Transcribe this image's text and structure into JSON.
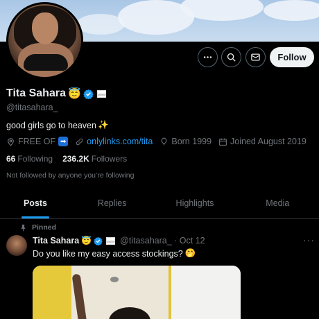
{
  "profile": {
    "display_name": "Tita Sahara",
    "name_emoji": "😇",
    "handle": "@titasahara_",
    "bio_text": "good girls go to heaven",
    "bio_emoji": "✨",
    "location": "FREE OF",
    "location_emoji": "➡",
    "website": "onlylinks.com/tita",
    "born": "Born 1999",
    "joined": "Joined August 2019",
    "following_count": "66",
    "following_label": "Following",
    "followers_count": "236.2K",
    "followers_label": "Followers",
    "not_followed": "Not followed by anyone you’re following"
  },
  "actions": {
    "more_icon": "more-icon",
    "search_icon": "search-icon",
    "message_icon": "message-icon",
    "follow_label": "Follow"
  },
  "tabs": [
    {
      "label": "Posts",
      "active": true
    },
    {
      "label": "Replies",
      "active": false
    },
    {
      "label": "Highlights",
      "active": false
    },
    {
      "label": "Media",
      "active": false
    }
  ],
  "post": {
    "pinned_label": "Pinned",
    "author": "Tita Sahara",
    "author_emoji": "😇",
    "handle_date": "@titasahara_ · Oct 12",
    "text": "Do you like my easy access stockings?",
    "text_emoji": "🤭",
    "more": "···"
  },
  "colors": {
    "accent": "#1d9bf0",
    "background": "#000000",
    "muted": "#71767b",
    "text": "#e7e9ea"
  }
}
